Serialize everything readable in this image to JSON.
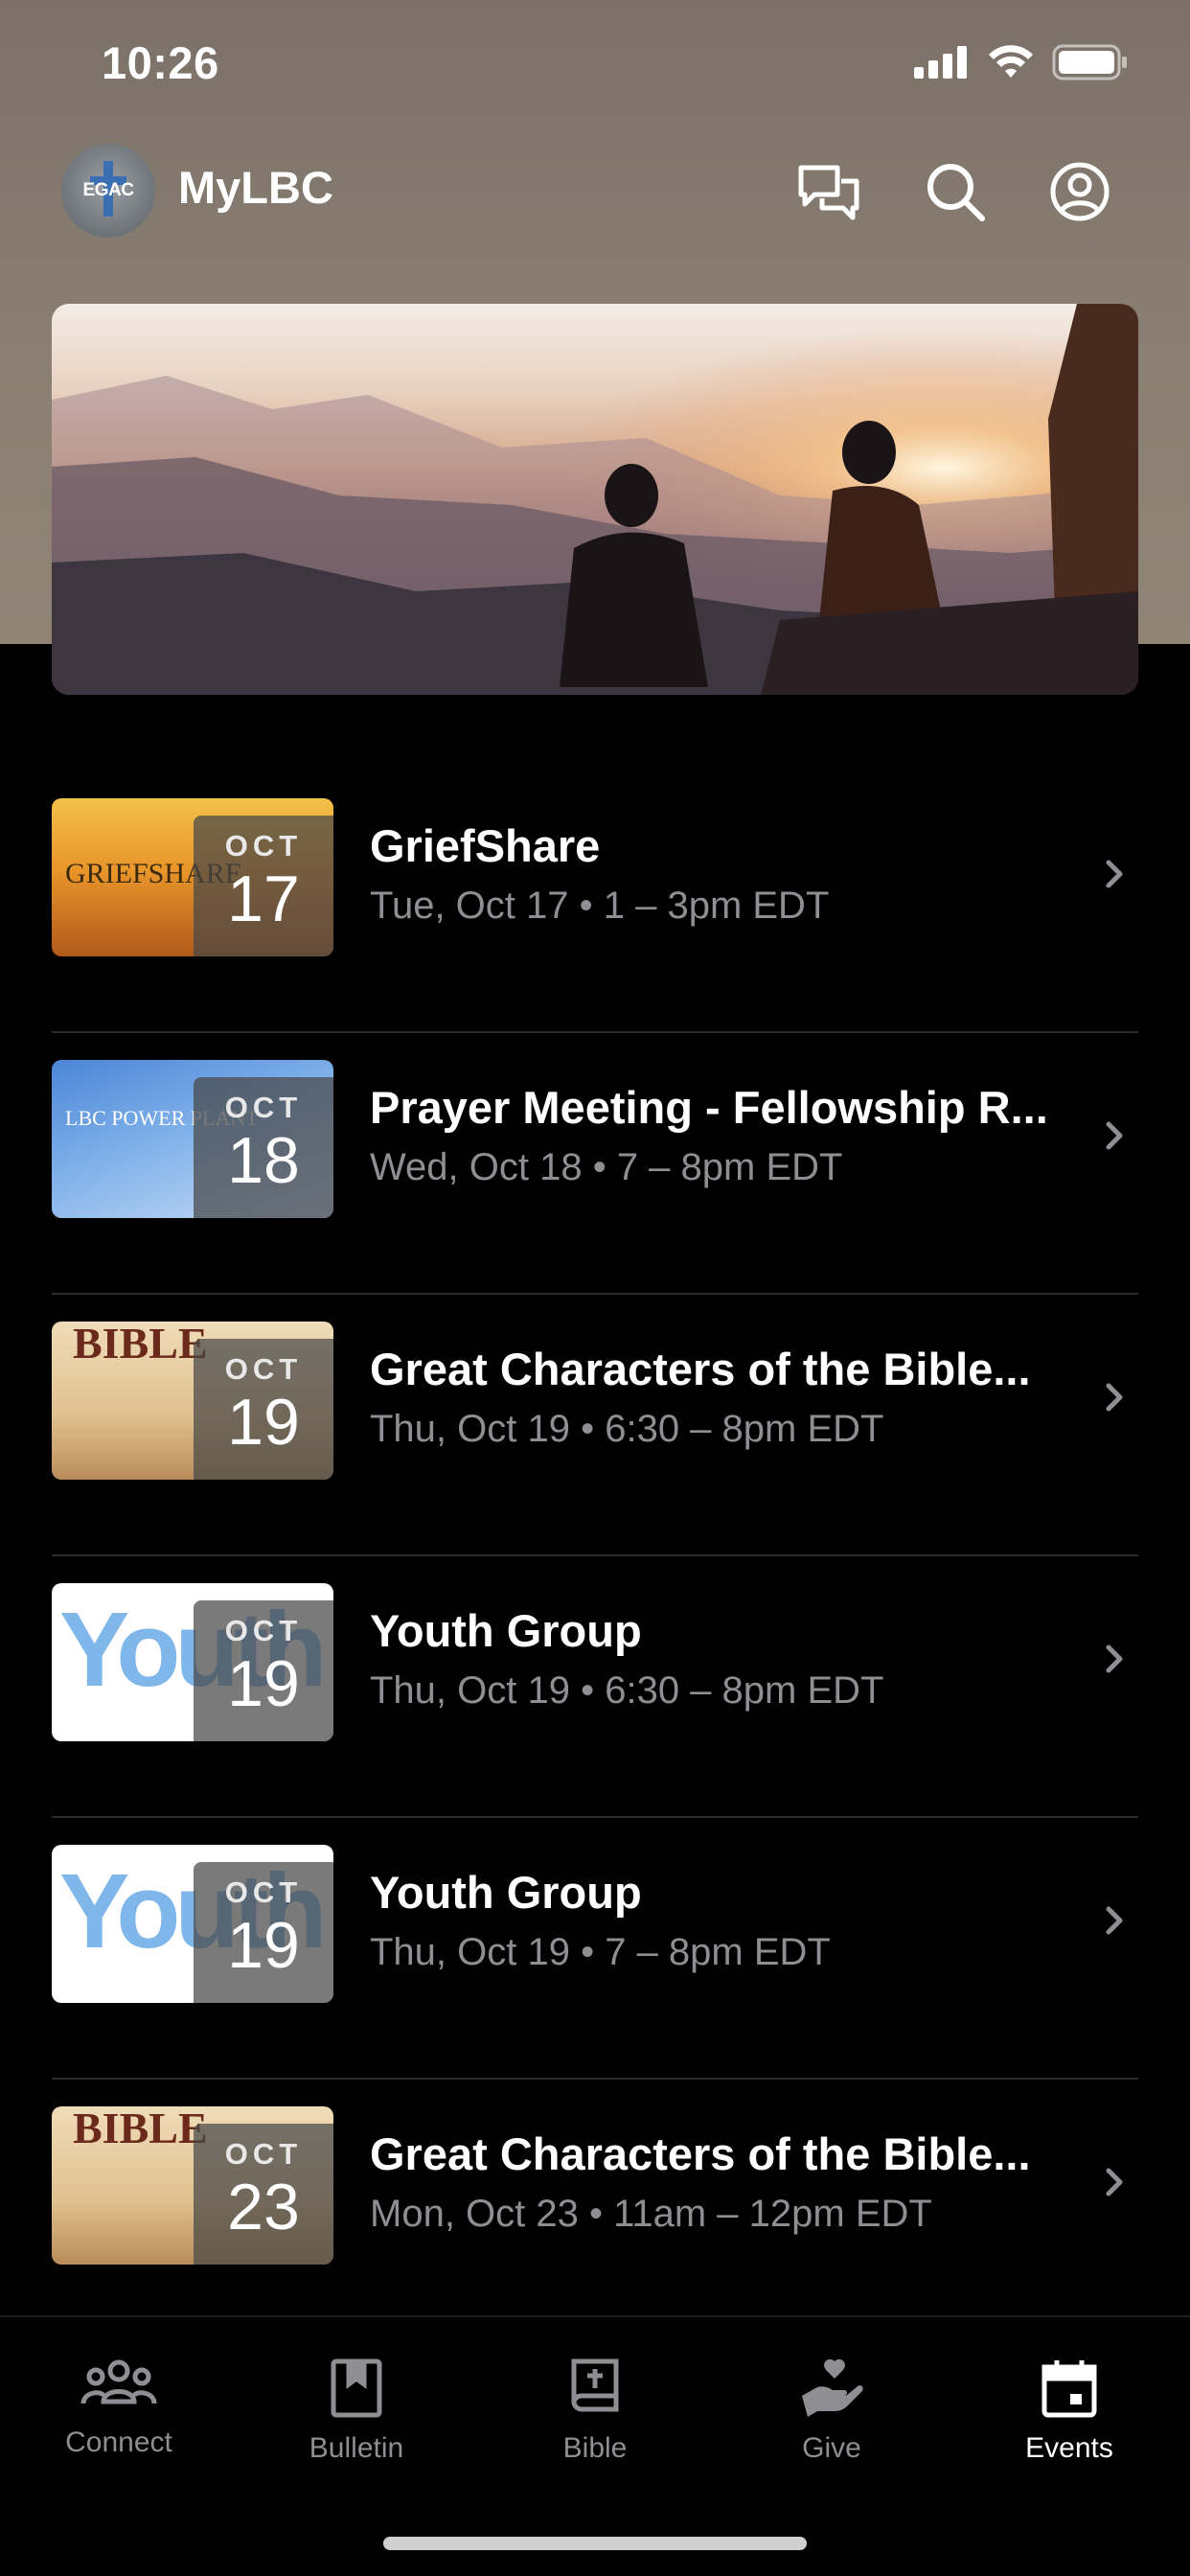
{
  "status_bar": {
    "time": "10:26"
  },
  "header": {
    "logo_text": "EGAC",
    "title": "MyLBC",
    "icons": [
      "chat-icon",
      "search-icon",
      "account-icon"
    ]
  },
  "events": [
    {
      "title": "GriefShare",
      "when": "Tue, Oct 17 • 1 – 3pm EDT",
      "month": "OCT",
      "day": "17",
      "thumb": "griefshare"
    },
    {
      "title": "Prayer Meeting - Fellowship R...",
      "when": "Wed, Oct 18 • 7 – 8pm EDT",
      "month": "OCT",
      "day": "18",
      "thumb": "prayer"
    },
    {
      "title": "Great Characters of the Bible...",
      "when": "Thu, Oct 19 • 6:30 – 8pm EDT",
      "month": "OCT",
      "day": "19",
      "thumb": "bible"
    },
    {
      "title": "Youth Group",
      "when": "Thu, Oct 19 • 6:30 – 8pm EDT",
      "month": "OCT",
      "day": "19",
      "thumb": "youth"
    },
    {
      "title": "Youth Group",
      "when": "Thu, Oct 19 • 7 – 8pm EDT",
      "month": "OCT",
      "day": "19",
      "thumb": "youth"
    },
    {
      "title": "Great Characters of the Bible...",
      "when": "Mon, Oct 23 • 11am – 12pm EDT",
      "month": "OCT",
      "day": "23",
      "thumb": "bible"
    }
  ],
  "thumb_text": {
    "griefshare": "GRIEFSHARE",
    "prayer": "LBC POWER PLANT",
    "bible": "BIBLE",
    "youth": "Youth"
  },
  "tabs": [
    {
      "label": "Connect",
      "icon": "people-icon",
      "active": false
    },
    {
      "label": "Bulletin",
      "icon": "bookmark-book-icon",
      "active": false
    },
    {
      "label": "Bible",
      "icon": "bible-icon",
      "active": false
    },
    {
      "label": "Give",
      "icon": "give-heart-hand-icon",
      "active": false
    },
    {
      "label": "Events",
      "icon": "calendar-icon",
      "active": true
    }
  ]
}
